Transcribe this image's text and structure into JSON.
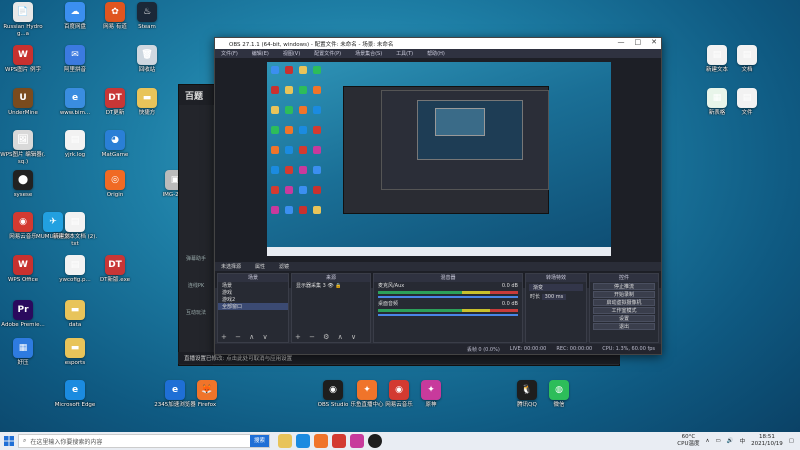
{
  "desktop": {
    "icons": [
      {
        "label": "Russian Hydrog...a",
        "color": "#e8e8e8",
        "glyph": "📄"
      },
      {
        "label": "WPS图片 例字",
        "color": "#c8312f",
        "glyph": "W"
      },
      {
        "label": "UnderMine",
        "color": "#7a4b1e",
        "glyph": "U"
      },
      {
        "label": "WPS图片 编辑器(.sq.)",
        "color": "#d9d9d9",
        "glyph": "🖼"
      },
      {
        "label": "sysese",
        "color": "#222",
        "glyph": "⬤"
      },
      {
        "label": "网易云音乐",
        "color": "#d33a31",
        "glyph": "◉"
      },
      {
        "label": "WPS Office",
        "color": "#c8312f",
        "glyph": "W"
      },
      {
        "label": "Adobe Premie...",
        "color": "#2a0a5e",
        "glyph": "Pr"
      },
      {
        "label": "好压",
        "color": "#2e7be0",
        "glyph": "▦"
      },
      {
        "label": "百度网盘",
        "color": "#3b8ff0",
        "glyph": "☁"
      },
      {
        "label": "阿里拼音",
        "color": "#3b7ae0",
        "glyph": "✉"
      },
      {
        "label": "www.bim...",
        "color": "#3a8de0",
        "glyph": "e"
      },
      {
        "label": "yjrk.log",
        "color": "#f2f2f2",
        "glyph": "▤"
      },
      {
        "label": "MUMU模拟器",
        "color": "#22a0e0",
        "glyph": "✈"
      },
      {
        "label": "ywcofig.p...",
        "color": "#f2f2f2",
        "glyph": "▤"
      },
      {
        "label": "data",
        "color": "#e8c45a",
        "glyph": "▬"
      },
      {
        "label": "esports",
        "color": "#e8c45a",
        "glyph": "▬"
      },
      {
        "label": "Microsoft Edge",
        "color": "#1b8be0",
        "glyph": "e"
      },
      {
        "label": "网易 有道",
        "color": "#e0551f",
        "glyph": "✿"
      },
      {
        "label": "DT更新",
        "color": "#c83636",
        "glyph": "DT"
      },
      {
        "label": "MatGame",
        "color": "#2a7fd6",
        "glyph": "◕"
      },
      {
        "label": "Origin",
        "color": "#f06a24",
        "glyph": "◎"
      },
      {
        "label": "新建文本文档 (2).txt",
        "color": "#f2f2f2",
        "glyph": "▤"
      },
      {
        "label": "DT新版.exe",
        "color": "#c83636",
        "glyph": "DT"
      },
      {
        "label": "Steam",
        "color": "#1b2838",
        "glyph": "♨"
      },
      {
        "label": "回收站",
        "color": "#cfd8e0",
        "glyph": "🗑"
      },
      {
        "label": "快捷方",
        "color": "#e8c45a",
        "glyph": "▬"
      },
      {
        "label": "IMG-20...",
        "color": "#bbb",
        "glyph": "▣"
      },
      {
        "label": "2345加速浏览器",
        "color": "#1f6fd6",
        "glyph": "e"
      },
      {
        "label": "Firefox",
        "color": "#f0742a",
        "glyph": "🦊"
      },
      {
        "label": "OBS Studio",
        "color": "#1e1e1e",
        "glyph": "◉"
      },
      {
        "label": "乐鱼直播中心",
        "color": "#f0742a",
        "glyph": "✦"
      },
      {
        "label": "网易云音乐",
        "color": "#d33a31",
        "glyph": "◉"
      },
      {
        "label": "原神",
        "color": "#c83a9c",
        "glyph": "✦"
      },
      {
        "label": "腾讯QQ",
        "color": "#1e1e1e",
        "glyph": "🐧"
      },
      {
        "label": "微信",
        "color": "#2dbd5a",
        "glyph": "◍"
      },
      {
        "label": "新建文本",
        "color": "#f2f2f2",
        "glyph": "▤"
      },
      {
        "label": "文档",
        "color": "#f2f2f2",
        "glyph": "▤"
      },
      {
        "label": "新表格",
        "color": "#e8f5ea",
        "glyph": "▦"
      },
      {
        "label": "文件",
        "color": "#f2f2f2",
        "glyph": "▤"
      }
    ]
  },
  "obs_back": {
    "title": "百题",
    "side_items": [
      "弹幕助手",
      "连线PK",
      "互动玩法"
    ]
  },
  "obs": {
    "title": "OBS 27.1.1 (64-bit, windows) - 配置文件: 未命名 - 场景: 未命名",
    "window_controls": [
      "—",
      "□",
      "✕"
    ],
    "menu": [
      "文件(F)",
      "编辑(E)",
      "视图(V)",
      "配置文件(P)",
      "场景集合(S)",
      "工具(T)",
      "帮助(H)"
    ],
    "source_bar": {
      "label": "未选择源",
      "props": "属性",
      "filters": "滤镜"
    },
    "scenes": {
      "header": "场景",
      "items": [
        "场景",
        "游戏",
        "游戏2",
        "全部窗口"
      ],
      "selected": 3
    },
    "sources": {
      "header": "来源",
      "items": [
        "显示器采集 3"
      ]
    },
    "mixer": {
      "header": "混音器",
      "tracks": [
        {
          "name": "麦克风/Aux",
          "db": "0.0 dB"
        },
        {
          "name": "桌面音频",
          "db": "0.0 dB"
        }
      ]
    },
    "transitions": {
      "header": "转场特效",
      "type": "渐变",
      "duration_label": "时长",
      "duration": "300 ms"
    },
    "controls": {
      "header": "控件",
      "buttons": [
        "停止推流",
        "开始录制",
        "启动虚拟摄像机",
        "工作室模式",
        "设置",
        "退出"
      ]
    },
    "status": {
      "live": "LIVE: 00:00:00",
      "rec": "REC: 00:00:00",
      "cpu": "CPU: 1.3%, 60.00 fps",
      "dropped": "丢帧 0 (0.0%)"
    }
  },
  "notice": "直播设置已修改: 点击此处可取消与应用设置",
  "taskbar": {
    "search_placeholder": "在这里输入你要搜索的内容",
    "search_button": "搜索",
    "weather": "60°C",
    "weather_label": "CPU温度",
    "time": "18:51",
    "date": "2021/10/19",
    "lang": "中"
  }
}
